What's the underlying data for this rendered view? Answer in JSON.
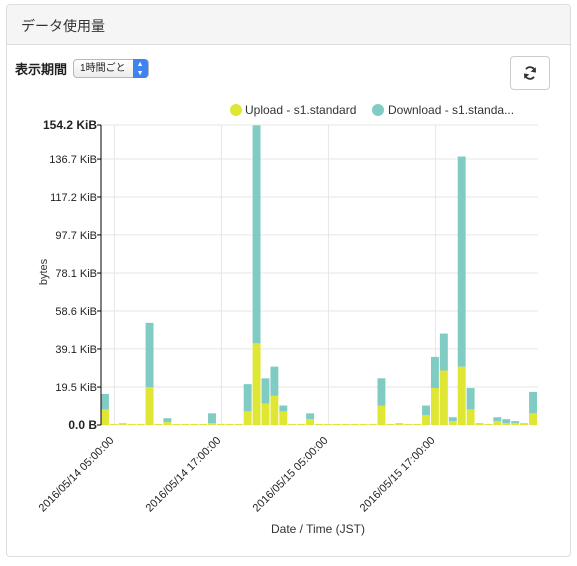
{
  "panel": {
    "title": "データ使用量"
  },
  "period": {
    "label": "表示期間",
    "selected": "1時間ごと"
  },
  "refresh": {
    "icon": "refresh-icon"
  },
  "colors": {
    "upload": "#dfe634",
    "download": "#80cbc4",
    "grid": "#e6e6e6"
  },
  "chart_data": {
    "type": "bar",
    "stacked": true,
    "xlabel": "Date / Time (JST)",
    "ylabel": "bytes",
    "ylim": [
      0,
      154.2
    ],
    "yunit": "KiB",
    "yticks": [
      "0.0 B",
      "19.5 KiB",
      "39.1 KiB",
      "58.6 KiB",
      "78.1 KiB",
      "97.7 KiB",
      "117.2 KiB",
      "136.7 KiB",
      "154.2 KiB"
    ],
    "ytick_values": [
      0,
      19.5,
      39.1,
      58.6,
      78.1,
      97.7,
      117.2,
      136.7,
      154.2
    ],
    "xticks": [
      "2016/05/14 05:00:00",
      "2016/05/14 17:00:00",
      "2016/05/15 05:00:00",
      "2016/05/15 17:00:00"
    ],
    "xtick_index": [
      1,
      13,
      25,
      37
    ],
    "legend": {
      "placement": "top-right",
      "entries": [
        "Upload - s1.standard",
        "Download - s1.standa..."
      ]
    },
    "series": [
      {
        "name": "Upload - s1.standard",
        "values": [
          8,
          0,
          1,
          0,
          0,
          19.5,
          0,
          1.5,
          0,
          0,
          0,
          0,
          1,
          0,
          0,
          0,
          7,
          42,
          11,
          15,
          7,
          0,
          0,
          3,
          0,
          0,
          0,
          0,
          0,
          0,
          0,
          10,
          0,
          1,
          0,
          0,
          5,
          19,
          28,
          2,
          30,
          8,
          1,
          0,
          2,
          1,
          1,
          1,
          6
        ]
      },
      {
        "name": "Download - s1.standa...",
        "values": [
          8,
          0,
          0,
          0,
          0,
          33,
          0,
          2,
          0,
          0,
          0,
          0,
          5,
          0,
          0,
          0,
          14,
          112,
          13,
          15,
          3,
          0,
          0,
          3,
          0,
          0,
          0,
          0,
          0,
          0,
          0,
          14,
          0,
          0,
          0,
          0,
          5,
          16,
          19,
          2,
          108,
          11,
          0,
          0,
          2,
          2,
          1,
          0,
          11
        ]
      }
    ]
  }
}
